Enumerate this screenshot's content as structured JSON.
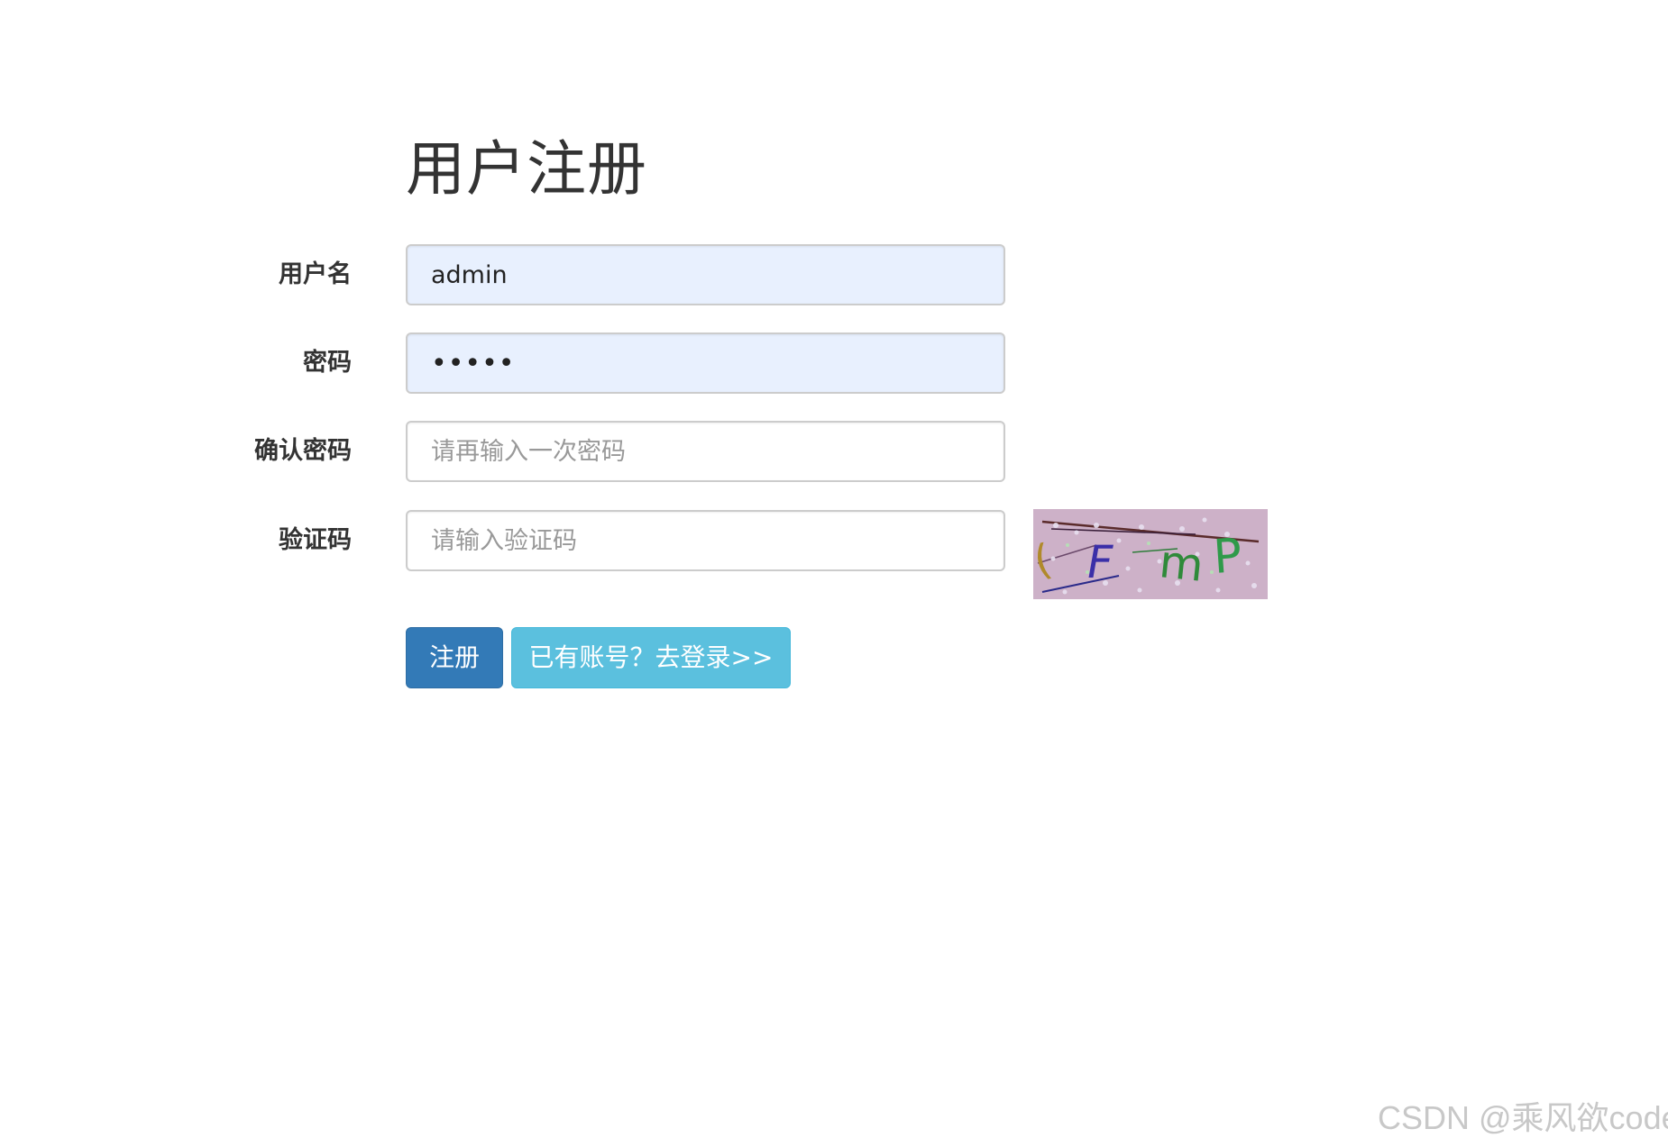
{
  "page": {
    "title": "用户注册"
  },
  "form": {
    "username": {
      "label": "用户名",
      "value": "admin",
      "placeholder": ""
    },
    "password": {
      "label": "密码",
      "value": "12345",
      "placeholder": ""
    },
    "confirm_password": {
      "label": "确认密码",
      "value": "",
      "placeholder": "请再输入一次密码"
    },
    "captcha": {
      "label": "验证码",
      "value": "",
      "placeholder": "请输入验证码",
      "image_text": "FmP"
    }
  },
  "buttons": {
    "register_label": "注册",
    "login_link_label": "已有账号？去登录>>"
  },
  "colors": {
    "primary": "#337ab7",
    "info": "#5bc0de",
    "autofill_bg": "#e8f0fe",
    "captcha_bg": "#cdb1c8"
  },
  "watermark": {
    "text": "CSDN @乘风欲code"
  }
}
